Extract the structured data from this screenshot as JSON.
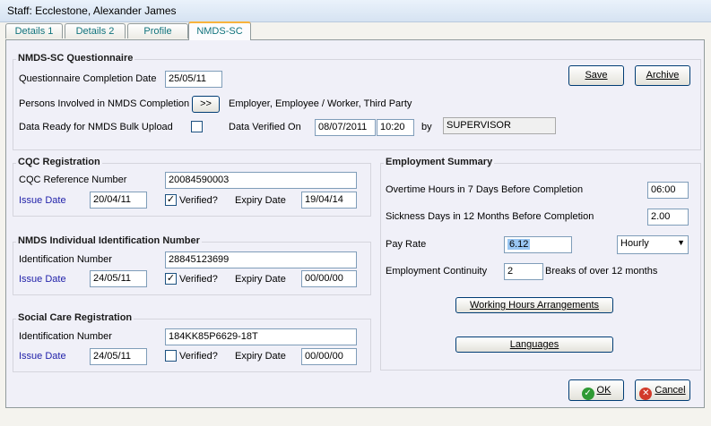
{
  "window": {
    "title": "Staff: Ecclestone, Alexander James"
  },
  "tabs": [
    {
      "label": "Details 1"
    },
    {
      "label": "Details 2"
    },
    {
      "label": "Profile"
    },
    {
      "label": "NMDS-SC"
    }
  ],
  "nmds": {
    "title": "NMDS-SC Questionnaire",
    "completion_date_label": "Questionnaire Completion Date",
    "completion_date": "25/05/11",
    "persons_label": "Persons Involved in NMDS Completion",
    "persons_button": ">>",
    "persons_value": "Employer, Employee / Worker, Third Party",
    "bulk_label": "Data Ready for NMDS Bulk Upload",
    "verified_on_label": "Data Verified On",
    "verified_date": "08/07/2011",
    "verified_time": "10:20",
    "by_label": "by",
    "by_value": "SUPERVISOR",
    "save_label": "Save",
    "archive_label": "Archive"
  },
  "cqc": {
    "title": "CQC Registration",
    "ref_label": "CQC Reference Number",
    "ref_value": "20084590003",
    "issue_label": "Issue Date",
    "issue_value": "20/04/11",
    "verified_label": "Verified?",
    "expiry_label": "Expiry Date",
    "expiry_value": "19/04/14"
  },
  "nmds_id": {
    "title": "NMDS Individual Identification Number",
    "id_label": "Identification Number",
    "id_value": "28845123699",
    "issue_label": "Issue Date",
    "issue_value": "24/05/11",
    "verified_label": "Verified?",
    "expiry_label": "Expiry Date",
    "expiry_value": "00/00/00"
  },
  "scr": {
    "title": "Social Care Registration",
    "id_label": "Identification Number",
    "id_value": "184KK85P6629-18T",
    "issue_label": "Issue Date",
    "issue_value": "24/05/11",
    "verified_label": "Verified?",
    "expiry_label": "Expiry Date",
    "expiry_value": "00/00/00"
  },
  "employment": {
    "title": "Employment Summary",
    "overtime_label": "Overtime Hours in 7 Days Before Completion",
    "overtime_value": "06:00",
    "sickness_label": "Sickness Days in 12 Months Before Completion",
    "sickness_value": "2.00",
    "payrate_label": "Pay Rate",
    "payrate_value": "6.12",
    "payrate_unit": "Hourly",
    "continuity_label": "Employment Continuity",
    "continuity_value": "2",
    "continuity_suffix": "Breaks of over 12 months",
    "working_hours_button": "Working Hours Arrangements",
    "languages_button": "Languages"
  },
  "footer": {
    "ok_label": "OK",
    "cancel_label": "Cancel"
  },
  "colors": {
    "ok_icon": "#2f9a34",
    "cancel_icon": "#d23a2a",
    "active_tab_accent": "#f8b33c"
  }
}
